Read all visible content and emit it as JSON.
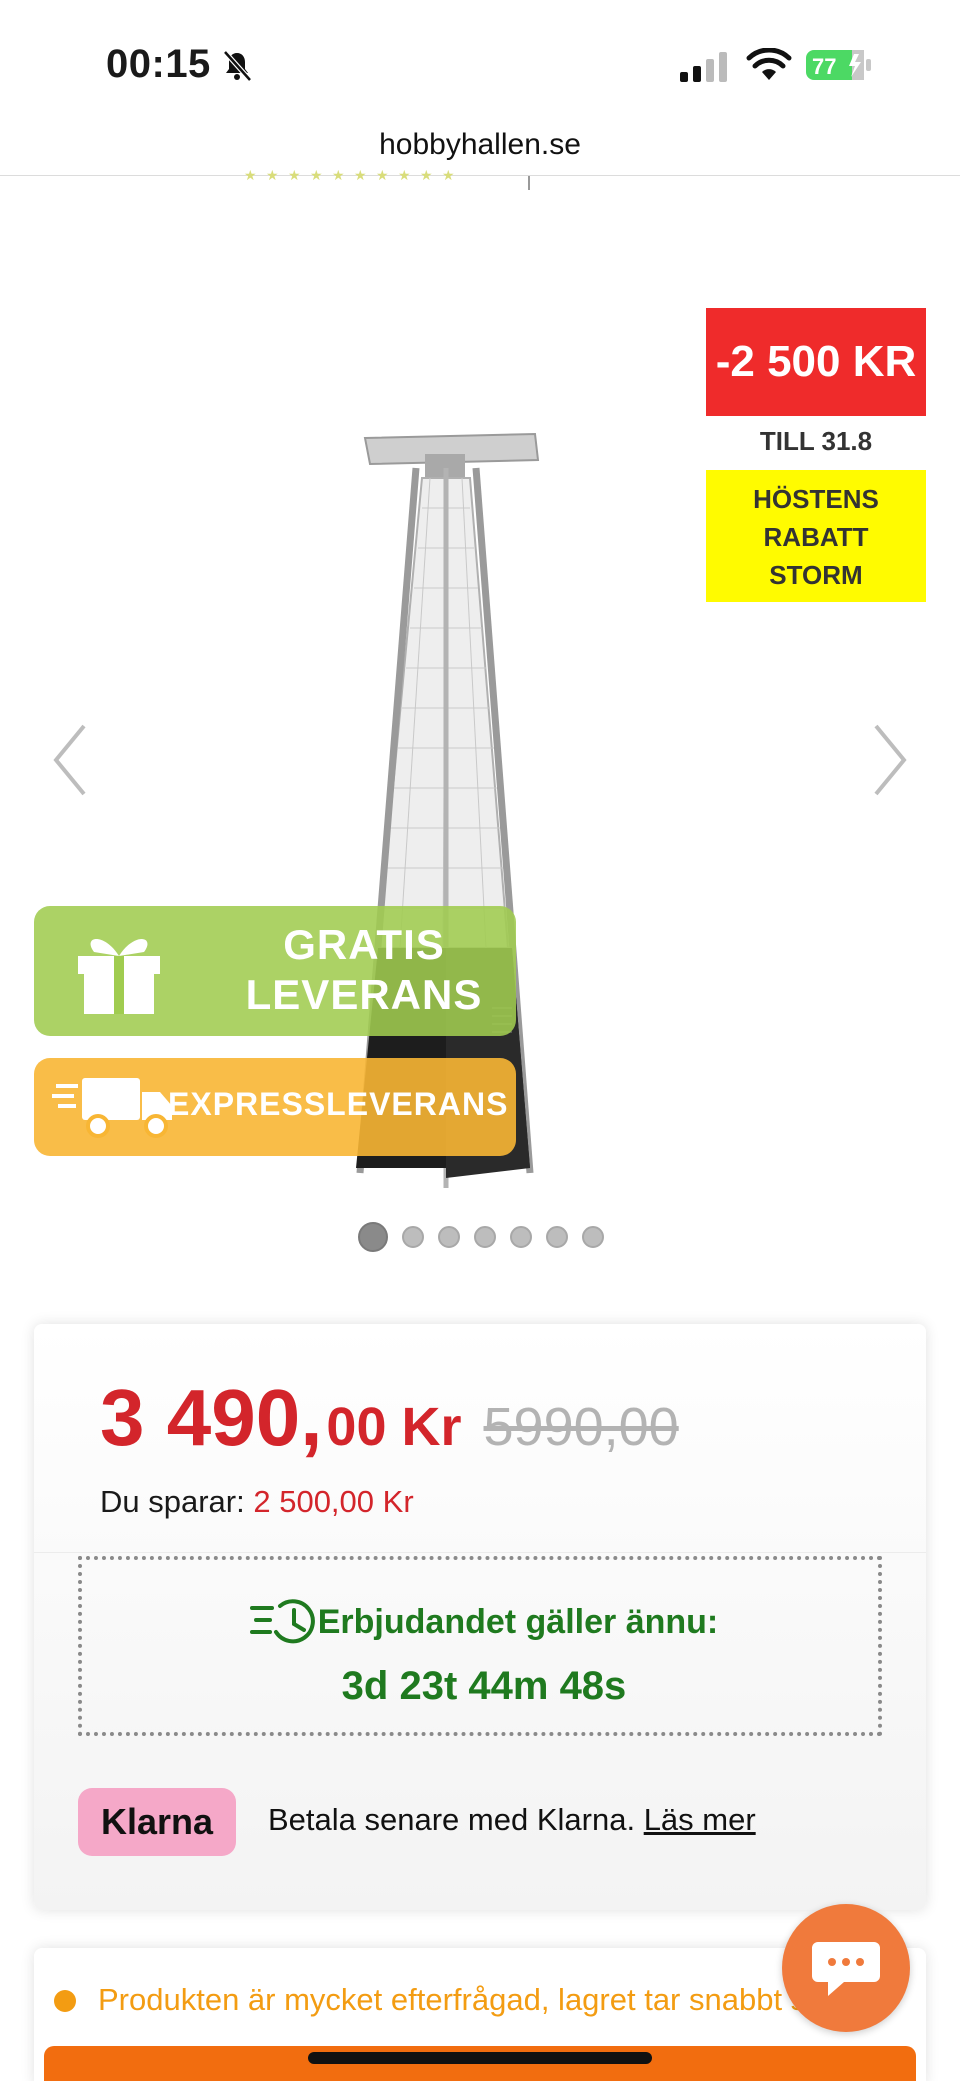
{
  "status_bar": {
    "time": "00:15",
    "battery": "77"
  },
  "browser": {
    "url": "hobbyhallen.se"
  },
  "gallery": {
    "discount_label": "-2 500 KR",
    "valid_until": "TILL 31.8",
    "campaign_lines": [
      "HÖSTENS",
      "RABATT",
      "STORM"
    ],
    "free_delivery_lines": [
      "GRATIS",
      "LEVERANS"
    ],
    "express_label": "EXPRESSLEVERANS",
    "dot_count": 7,
    "active_dot": 1
  },
  "price": {
    "current_main": "3 490,",
    "current_decimals": "00 Kr",
    "original": "5990,00",
    "saving_label": "Du sparar:",
    "saving_amount": "2 500,00 Kr"
  },
  "offer": {
    "title": "Erbjudandet gäller ännu:",
    "countdown": "3d 23t 44m 48s"
  },
  "klarna": {
    "logo": "Klarna",
    "text": "Betala senare med Klarna.",
    "link": "Läs mer"
  },
  "stock": {
    "notice": "Produkten är mycket efterfrågad, lagret tar snabbt slut"
  },
  "colors": {
    "price_red": "#d3252b",
    "discount_red": "#ef2b2b",
    "campaign_yellow": "#fffb00",
    "offer_green": "#1f7a1f",
    "klarna_pink": "#f5a8c8",
    "stock_orange": "#f39c12",
    "cta_orange": "#f26d0f",
    "battery_green": "#4cd964"
  },
  "icons": [
    "bell-slash-icon",
    "cellular-signal-icon",
    "wifi-icon",
    "battery-icon",
    "chevron-left-icon",
    "chevron-right-icon",
    "gift-icon",
    "truck-icon",
    "timer-icon",
    "chat-icon"
  ]
}
